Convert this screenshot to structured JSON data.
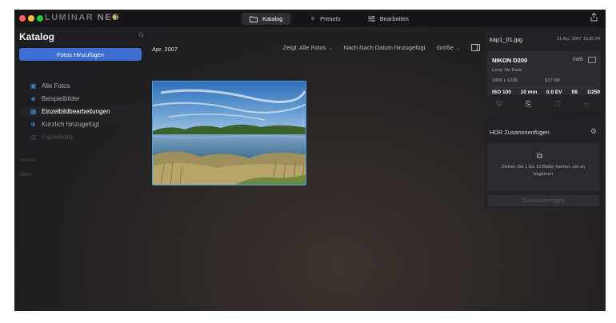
{
  "app": {
    "logo_text": "LUMINAR",
    "logo_suffix": "NEO",
    "traffic_colors": [
      "#ff5f57",
      "#febc2e",
      "#28c840"
    ],
    "accent": "#3d6fd0",
    "selection_color": "#4aa0e8"
  },
  "topnav": {
    "tabs": [
      {
        "label": "Katalog",
        "icon": "folder-icon",
        "active": true
      },
      {
        "label": "Presets",
        "icon": "sparkle-icon",
        "active": false
      },
      {
        "label": "Bearbeiten",
        "icon": "sliders-icon",
        "active": false
      }
    ]
  },
  "sidebar": {
    "title": "Katalog",
    "add_button": "Fotos Hinzufügen",
    "items": [
      {
        "label": "Alle Fotos",
        "icon": "calendar-icon"
      },
      {
        "label": "Beispielbilder",
        "icon": "layers-icon"
      },
      {
        "label": "Einzelbildbearbeitungen",
        "icon": "grid-icon",
        "active": true
      },
      {
        "label": "Kürzlich hinzugefügt",
        "icon": "plus-circle-icon"
      },
      {
        "label": "Papierkorb",
        "icon": "trash-icon"
      }
    ],
    "section_folders": "Ordner",
    "section_albums": "Alben"
  },
  "center": {
    "date_label": "Apr. 2007",
    "toolbar": {
      "show": "Zeigt: Alle Fotos",
      "sort": "Nach Nach Datum hinzugefügt",
      "size": "Größe"
    }
  },
  "info": {
    "filename": "kap1_01.jpg",
    "date": "21 Apr. 2007 13:05:24",
    "camera": "NIKON D200",
    "wb": "AWB",
    "lens": "Lens: No Data",
    "resolution": "1800 x 1205",
    "filesize": "627 KB",
    "iso": "ISO 100",
    "focal": "10 mm",
    "ev": "0.0 EV",
    "aperture": "f/8",
    "shutter": "1/250"
  },
  "hdr": {
    "title": "HDR Zusammenfügen",
    "drop_text": "Ziehen Sie 1 bis 10 Bilder hierher, um zu beginnen",
    "button": "Zusammenfügen"
  }
}
